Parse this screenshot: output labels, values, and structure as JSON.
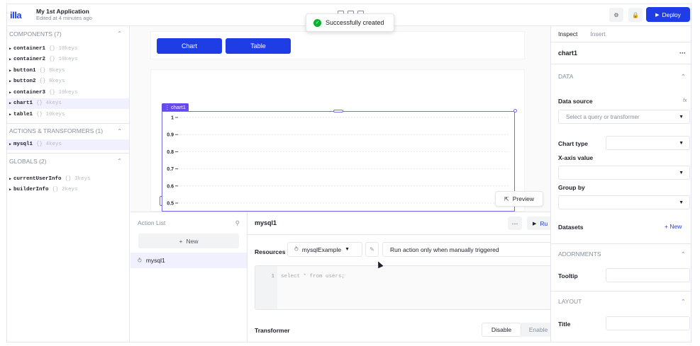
{
  "app": {
    "logo": "illa",
    "title": "My 1st Application",
    "subtitle": "Edited at 4 minutes ago"
  },
  "toolbar": {
    "deploy_label": "Deploy"
  },
  "toast": {
    "message": "Successfully created"
  },
  "sidebar": {
    "components_title": "COMPONENTS (7)",
    "components": [
      {
        "name": "container1",
        "meta": "{} 10keys"
      },
      {
        "name": "container2",
        "meta": "{} 10keys"
      },
      {
        "name": "button1",
        "meta": "{} 8keys"
      },
      {
        "name": "button2",
        "meta": "{} 8keys"
      },
      {
        "name": "container3",
        "meta": "{} 10keys"
      },
      {
        "name": "chart1",
        "meta": "{} 4keys"
      },
      {
        "name": "table1",
        "meta": "{} 10keys"
      }
    ],
    "actions_title": "ACTIONS & TRANSFORMERS (1)",
    "actions": [
      {
        "name": "mysql1",
        "meta": "{} 4keys"
      }
    ],
    "globals_title": "GLOBALS (2)",
    "globals": [
      {
        "name": "currentUserInfo",
        "meta": "{} 3keys"
      },
      {
        "name": "builderInfo",
        "meta": "{} 2keys"
      }
    ]
  },
  "canvas": {
    "buttons": [
      "Chart",
      "Table"
    ],
    "chart_label": "chart1",
    "preview_label": "Preview"
  },
  "chart_data": {
    "type": "line",
    "title": "",
    "xlabel": "",
    "ylabel": "",
    "y_ticks": [
      "1",
      "0.9",
      "0.8",
      "0.7",
      "0.6",
      "0.5"
    ],
    "ylim": [
      0.5,
      1
    ],
    "series": []
  },
  "action_panel": {
    "list_title": "Action List",
    "new_label": "New",
    "items": [
      {
        "name": "mysql1"
      }
    ],
    "editor_title": "mysql1",
    "more_label": "···",
    "run_label": "Ru",
    "resources_label": "Resources",
    "resource_value": "mysqlExample",
    "trigger_value": "Run action only when manually triggered",
    "code_line_number": "1",
    "code_placeholder": "select * from users;",
    "transformer_label": "Transformer",
    "disable_label": "Disable",
    "enable_label": "Enable"
  },
  "inspector": {
    "tabs": [
      "Inspect",
      "Insert"
    ],
    "component_name": "chart1",
    "more_label": "···",
    "data_section": "DATA",
    "data_source_label": "Data source",
    "fx_label": "fx",
    "data_source_placeholder": "Select a query or transformer",
    "chart_type_label": "Chart type",
    "xaxis_label": "X-axis value",
    "group_by_label": "Group by",
    "datasets_label": "Datasets",
    "datasets_new": "+ New",
    "adornments_section": "ADORNMENTS",
    "tooltip_label": "Tooltip",
    "layout_section": "LAYOUT",
    "title_label": "Title"
  },
  "colors": {
    "accent": "#1e3de4",
    "selection": "#654aec",
    "success": "#00b42a"
  }
}
